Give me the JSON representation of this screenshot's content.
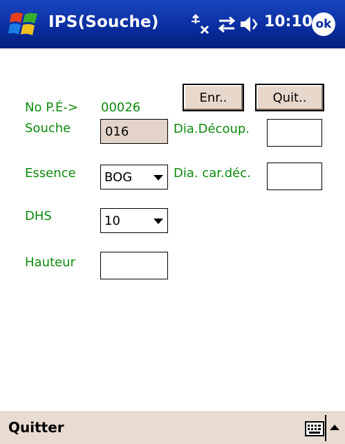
{
  "titlebar": {
    "title": "IPS(Souche)",
    "time": "10:10",
    "ok_label": "ok",
    "icons": [
      "windows-start-icon",
      "connectivity-icon",
      "sync-icon",
      "volume-icon"
    ]
  },
  "form": {
    "no_pe_label": "No P.É->",
    "no_pe_value": "00026",
    "save_button": "Enr..",
    "quit_button": "Quit..",
    "souche_label": "Souche",
    "souche_value": "016",
    "dia_decoup_label": "Dia.Découp.",
    "dia_decoup_value": "",
    "essence_label": "Essence",
    "essence_value": "BOG",
    "dia_car_dec_label": "Dia. car.déc.",
    "dia_car_dec_value": "",
    "dhs_label": "DHS",
    "dhs_value": "10",
    "hauteur_label": "Hauteur",
    "hauteur_value": ""
  },
  "bottombar": {
    "left_softkey": "Quitter",
    "icons": [
      "keyboard-icon",
      "sip-up-arrow-icon"
    ]
  },
  "colors": {
    "titlebar_blue": "#0a2ea0",
    "label_green": "#0c8a0c",
    "button_face": "#e8d8cc",
    "bottom_bar": "#e8dcd2"
  }
}
